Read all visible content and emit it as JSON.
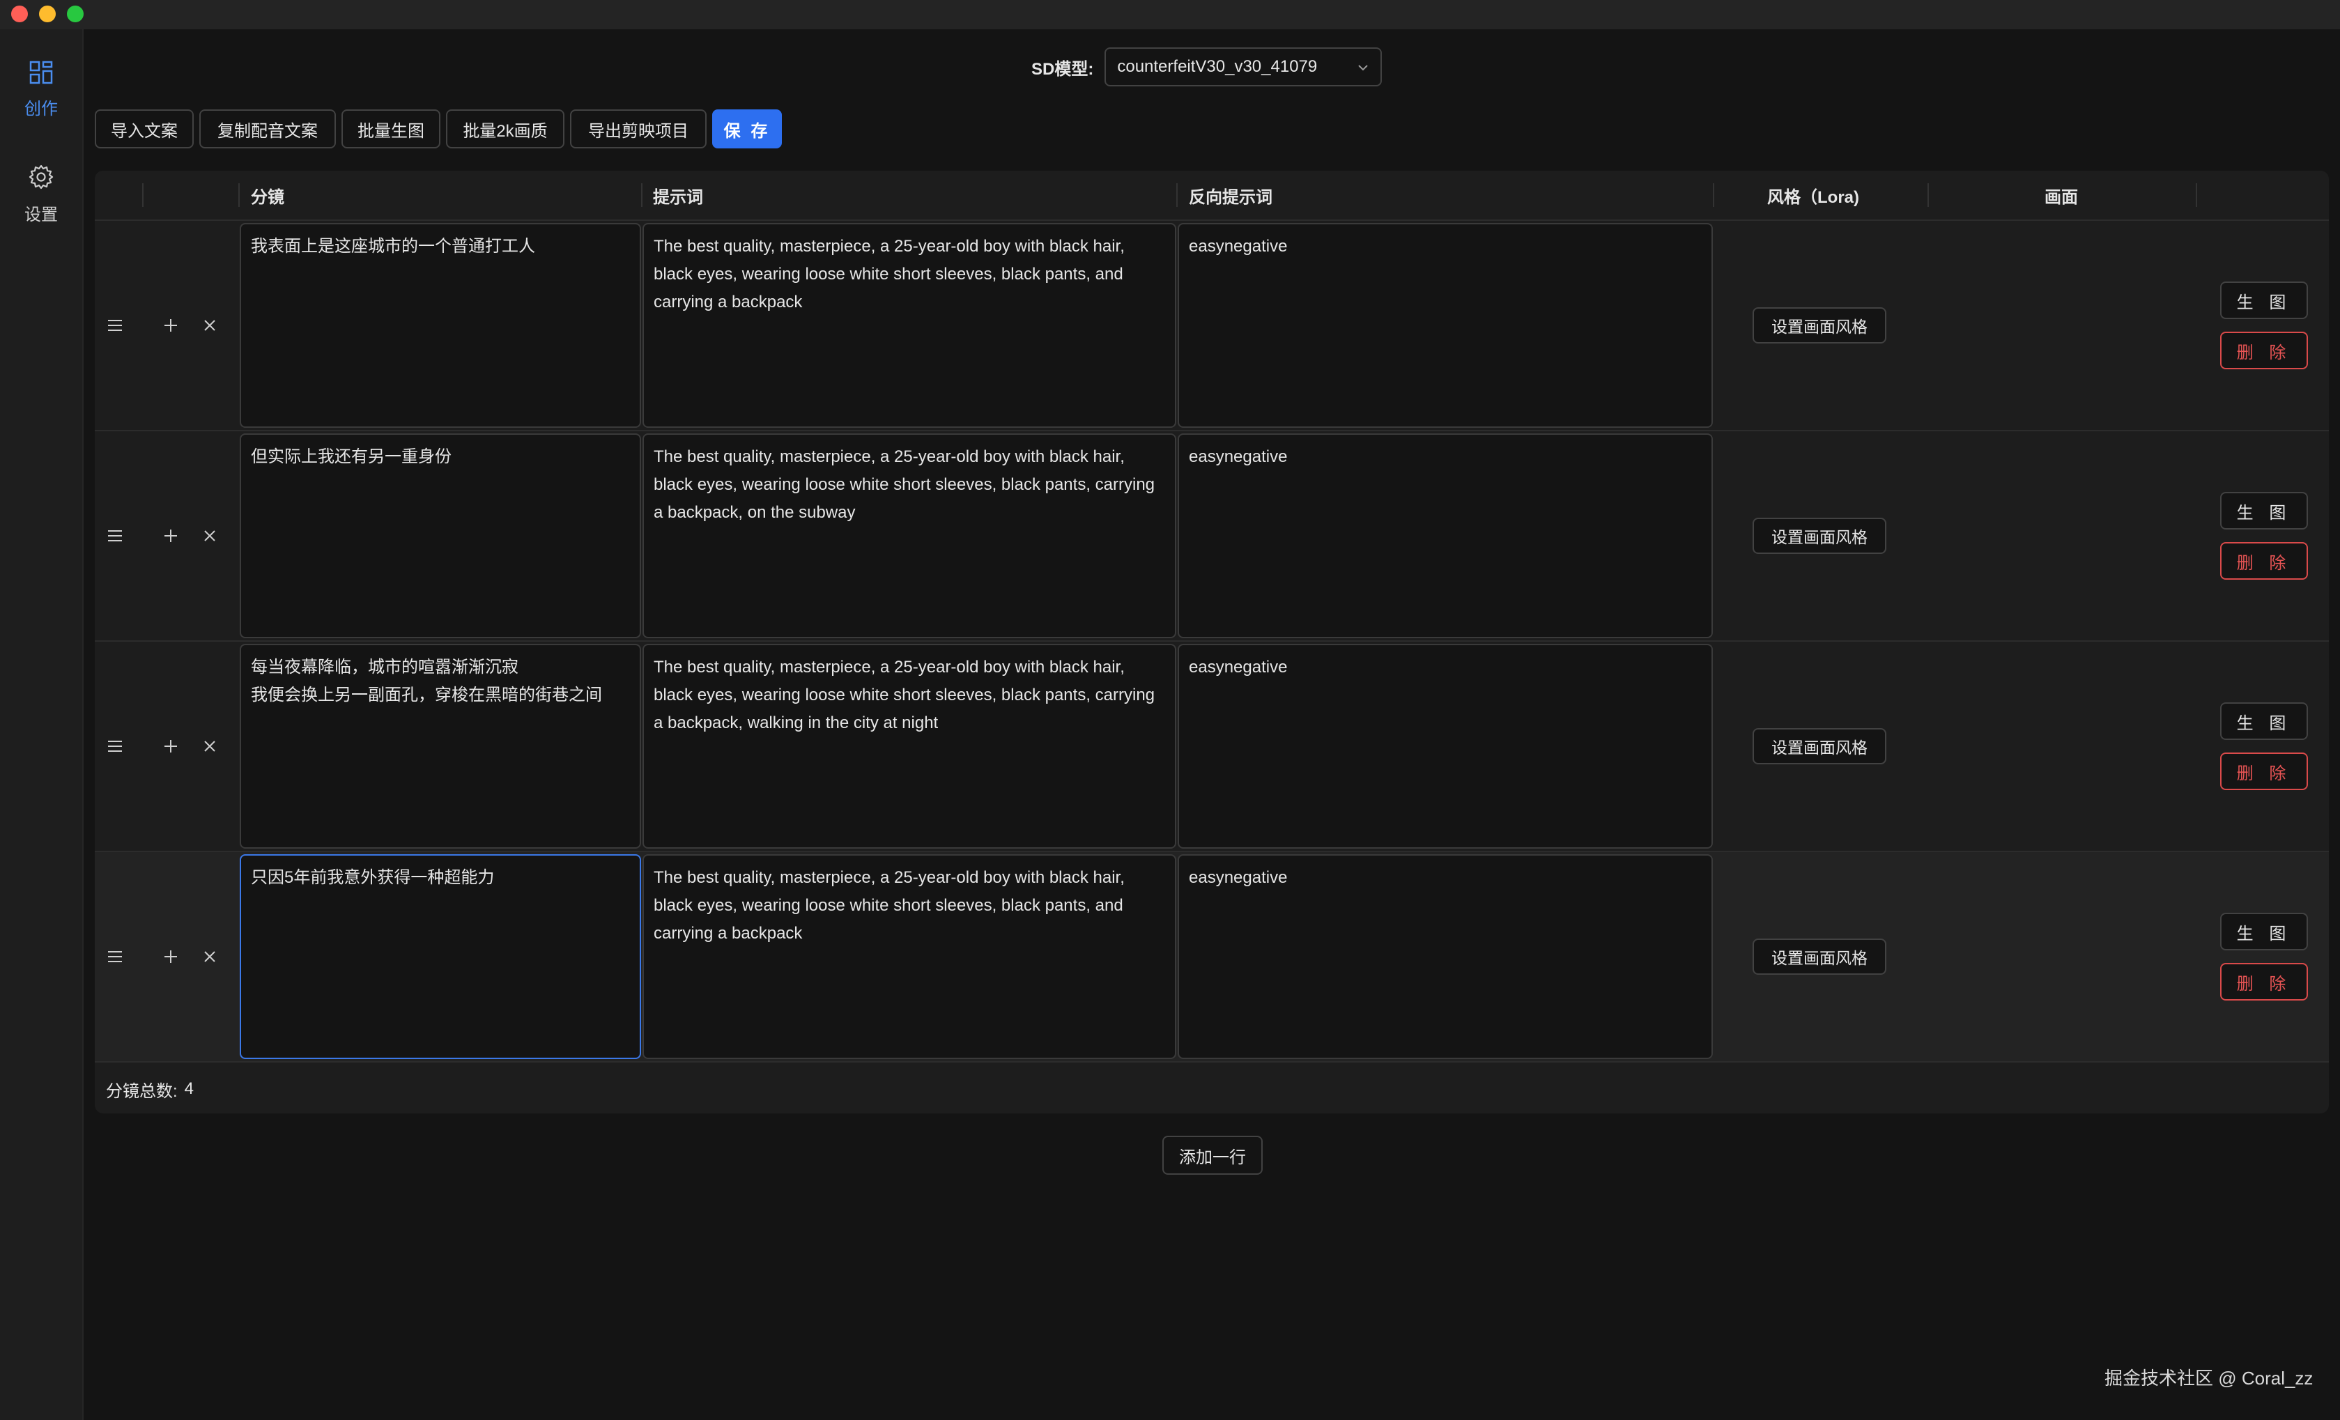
{
  "sidebar": {
    "items": [
      {
        "label": "创作",
        "icon": "grid-icon",
        "active": true
      },
      {
        "label": "设置",
        "icon": "gear-icon",
        "active": false
      }
    ]
  },
  "model": {
    "label": "SD模型:",
    "value": "counterfeitV30_v30_41079"
  },
  "toolbar": {
    "import_label": "导入文案",
    "copy_voice_label": "复制配音文案",
    "batch_generate_label": "批量生图",
    "batch_2k_label": "批量2k画质",
    "export_label": "导出剪映项目",
    "save_label": "保 存"
  },
  "table": {
    "headers": {
      "storyboard": "分镜",
      "prompt": "提示词",
      "negative_prompt": "反向提示词",
      "style": "风格（Lora)",
      "image": "画面"
    },
    "rows": [
      {
        "storyboard": "我表面上是这座城市的一个普通打工人",
        "prompt": "The best quality, masterpiece, a 25-year-old boy with black hair, black eyes, wearing loose white short sleeves, black pants, and carrying a backpack",
        "negative_prompt": "easynegative",
        "style_button": "设置画面风格",
        "generate_button": "生 图",
        "delete_button": "删 除"
      },
      {
        "storyboard": "但实际上我还有另一重身份",
        "prompt": "The best quality, masterpiece, a 25-year-old boy with black hair, black eyes, wearing loose white short sleeves, black pants, carrying a backpack, on the subway",
        "negative_prompt": "easynegative",
        "style_button": "设置画面风格",
        "generate_button": "生 图",
        "delete_button": "删 除"
      },
      {
        "storyboard": "每当夜幕降临，城市的喧嚣渐渐沉寂\n我便会换上另一副面孔，穿梭在黑暗的街巷之间",
        "prompt": "The best quality, masterpiece, a 25-year-old boy with black hair, black eyes, wearing loose white short sleeves, black pants, carrying a backpack, walking in the city at night",
        "negative_prompt": "easynegative",
        "style_button": "设置画面风格",
        "generate_button": "生 图",
        "delete_button": "删 除"
      },
      {
        "storyboard": "只因5年前我意外获得一种超能力",
        "prompt": "The best quality, masterpiece, a 25-year-old boy with black hair, black eyes, wearing loose white short sleeves, black pants, and carrying a backpack",
        "negative_prompt": "easynegative",
        "style_button": "设置画面风格",
        "generate_button": "生 图",
        "delete_button": "删 除"
      }
    ],
    "footer": {
      "total_label": "分镜总数:",
      "total_value": "4"
    }
  },
  "add_row_label": "添加一行",
  "watermark": "掘金技术社区 @ Coral_zz",
  "colors": {
    "accent": "#2d6ff0",
    "danger": "#e85454",
    "background": "#141414"
  }
}
